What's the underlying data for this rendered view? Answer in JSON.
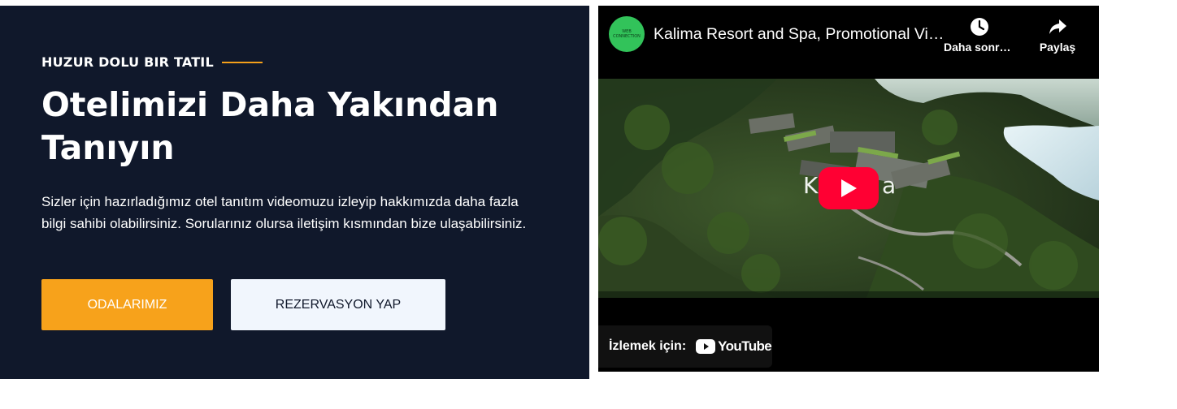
{
  "hero": {
    "eyebrow": "HUZUR DOLU BIR TATIL",
    "title": "Otelimizi Daha Yakından Tanıyın",
    "description": "Sizler için hazırladığımız otel tanıtım videomuzu izleyip hakkımızda daha fazla bilgi sahibi olabilirsiniz. Sorularınız olursa iletişim kısmından bize ulaşabilirsiniz.",
    "buttons": {
      "rooms": "ODALARIMIZ",
      "reservation": "REZERVASYON YAP"
    },
    "colors": {
      "panel": "#10182b",
      "accent": "#f7a21b",
      "secondary": "#f1f6fd"
    }
  },
  "video": {
    "channel_avatar_text": "WEB CONNECTION",
    "title": "Kalima Resort and Spa, Promotional Video",
    "watch_later": "Daha sonra izle",
    "share": "Paylaş",
    "overlay_left": "K",
    "overlay_right": "a",
    "watch_on_label": "İzlemek için:",
    "youtube_logo": "YouTube",
    "icons": {
      "watch_later": "clock-icon",
      "share": "share-arrow-icon",
      "play": "play-icon"
    },
    "colors": {
      "play": "#ff0033",
      "avatar": "#32c35a"
    }
  }
}
